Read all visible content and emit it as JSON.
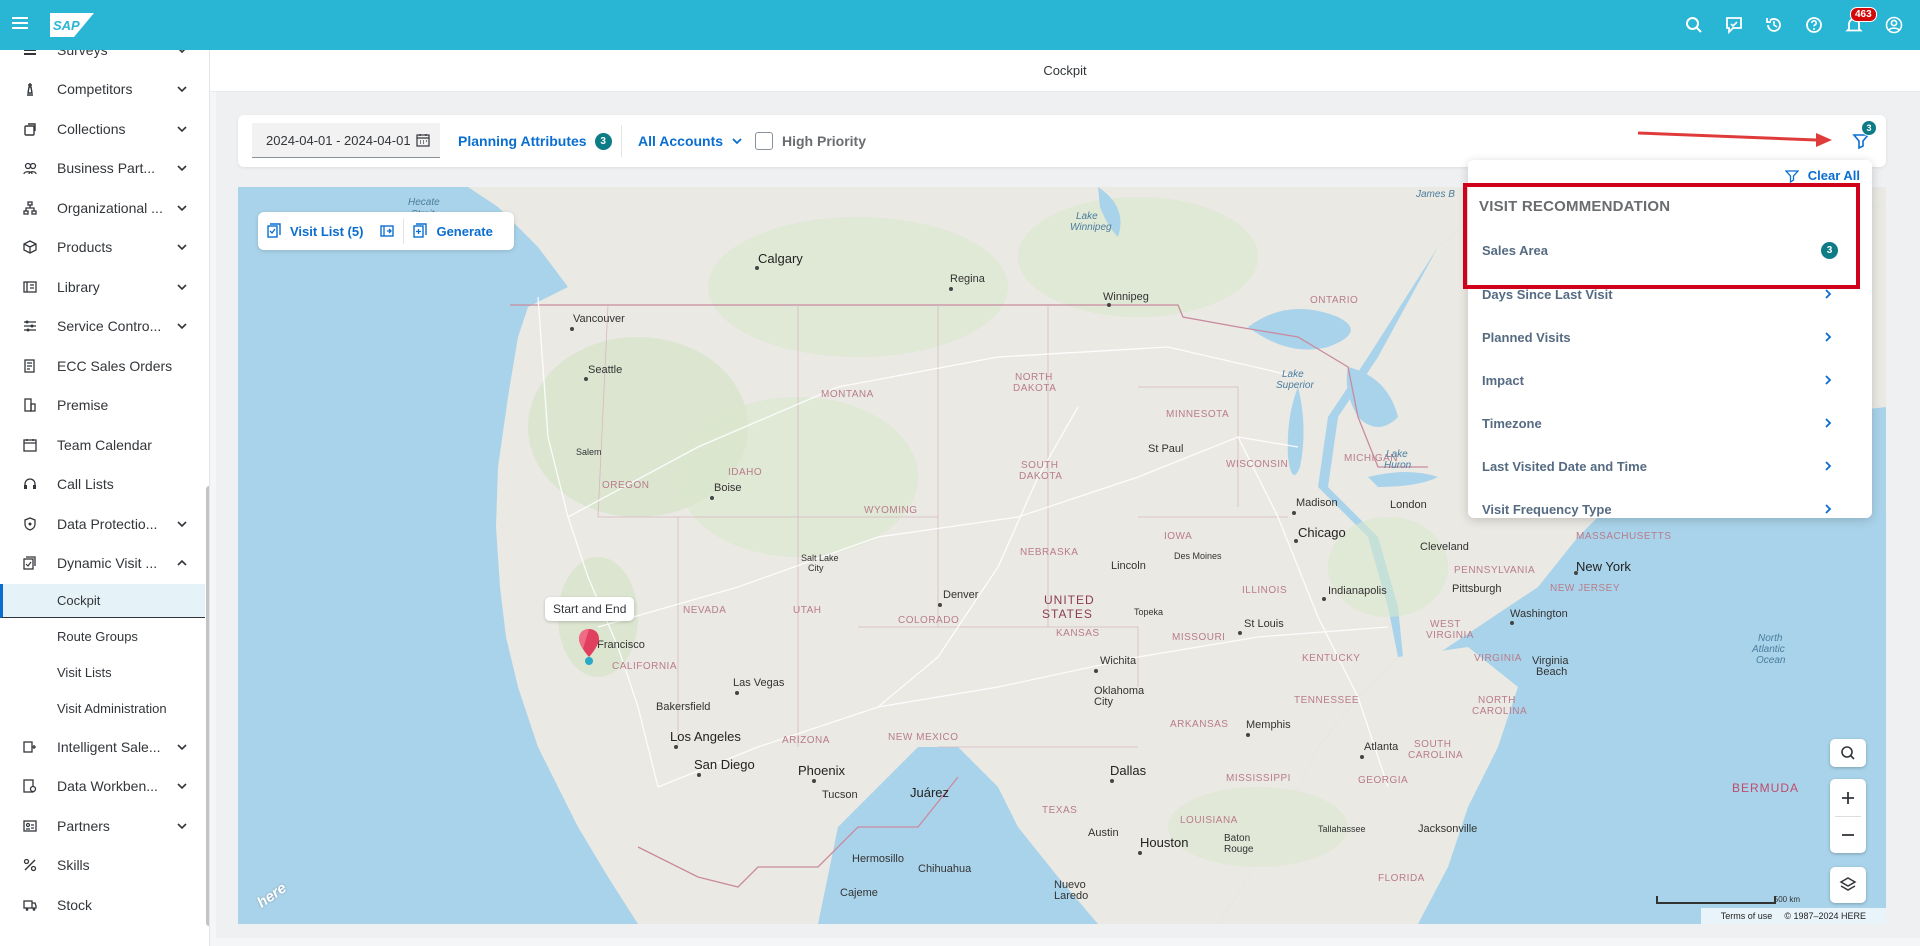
{
  "header": {
    "logo_text": "SAP",
    "notifications_count": "463"
  },
  "sidebar": {
    "items": [
      {
        "label": "Surveys",
        "icon": "list-icon",
        "expandable": true
      },
      {
        "label": "Competitors",
        "icon": "chess-icon",
        "expandable": true
      },
      {
        "label": "Collections",
        "icon": "collections-icon",
        "expandable": true
      },
      {
        "label": "Business Part...",
        "icon": "partners-icon",
        "expandable": true
      },
      {
        "label": "Organizational ...",
        "icon": "org-icon",
        "expandable": true
      },
      {
        "label": "Products",
        "icon": "product-icon",
        "expandable": true
      },
      {
        "label": "Library",
        "icon": "library-icon",
        "expandable": true
      },
      {
        "label": "Service Contro...",
        "icon": "controls-icon",
        "expandable": true
      },
      {
        "label": "ECC Sales Orders",
        "icon": "orders-icon",
        "expandable": false
      },
      {
        "label": "Premise",
        "icon": "building-icon",
        "expandable": false
      },
      {
        "label": "Team Calendar",
        "icon": "calendar-icon",
        "expandable": false
      },
      {
        "label": "Call Lists",
        "icon": "headset-icon",
        "expandable": false
      },
      {
        "label": "Data Protectio...",
        "icon": "shield-icon",
        "expandable": true
      },
      {
        "label": "Dynamic Visit ...",
        "icon": "visit-icon",
        "expandable": true,
        "expanded": true
      }
    ],
    "subitems": [
      {
        "label": "Cockpit",
        "active": true
      },
      {
        "label": "Route Groups"
      },
      {
        "label": "Visit Lists"
      },
      {
        "label": "Visit Administration"
      }
    ],
    "items_after": [
      {
        "label": "Intelligent Sale...",
        "icon": "intelligent-icon",
        "expandable": true
      },
      {
        "label": "Data Workben...",
        "icon": "workbench-icon",
        "expandable": true
      },
      {
        "label": "Partners",
        "icon": "partner-card-icon",
        "expandable": true
      },
      {
        "label": "Skills",
        "icon": "skills-icon",
        "expandable": false
      },
      {
        "label": "Stock",
        "icon": "truck-icon",
        "expandable": false
      }
    ]
  },
  "page": {
    "title": "Cockpit"
  },
  "filter_bar": {
    "date_range": "2024-04-01 - 2024-04-01",
    "planning_attributes_label": "Planning Attributes",
    "planning_attributes_count": "3",
    "accounts_label": "All Accounts",
    "high_priority_label": "High Priority",
    "filter_count": "3"
  },
  "map": {
    "visit_list_label": "Visit List (5)",
    "generate_label": "Generate",
    "tooltip": "Start and End",
    "scale_label": "500 km",
    "terms_label": "Terms of use",
    "copyright": "© 1987–2024 HERE",
    "provider_logo": "here",
    "labels": {
      "hecate": "Hecate",
      "strait": "Strait",
      "calgary": "Calgary",
      "regina": "Regina",
      "winnipeg": "Winnipeg",
      "lake_winnipeg": "Lake",
      "lake_winnipeg2": "Winnipeg",
      "vancouver": "Vancouver",
      "seattle": "Seattle",
      "ontario": "ONTARIO",
      "montana": "MONTANA",
      "north_dakota1": "NORTH",
      "north_dakota2": "DAKOTA",
      "minnesota": "MINNESOTA",
      "lake_superior1": "Lake",
      "lake_superior2": "Superior",
      "salem": "Salem",
      "oregon": "OREGON",
      "idaho": "IDAHO",
      "boise": "Boise",
      "wyoming": "WYOMING",
      "south_dakota1": "SOUTH",
      "south_dakota2": "DAKOTA",
      "st_paul": "St Paul",
      "wisconsin": "WISCONSIN",
      "michigan": "MICHIGAN",
      "lake_huron1": "Lake",
      "lake_huron2": "Huron",
      "madison": "Madison",
      "london": "London",
      "chicago": "Chicago",
      "iowa": "IOWA",
      "des_moines": "Des Moines",
      "nebraska": "NEBRASKA",
      "lincoln": "Lincoln",
      "nevada": "NEVADA",
      "utah": "UTAH",
      "salt_lake1": "Salt Lake",
      "salt_lake2": "City",
      "colorado": "COLORADO",
      "denver": "Denver",
      "united_states1": "UNITED",
      "united_states2": "STATES",
      "kansas": "KANSAS",
      "topeka": "Topeka",
      "missouri": "MISSOURI",
      "illinois": "ILLINOIS",
      "indianapolis": "Indianapolis",
      "st_louis": "St Louis",
      "cleveland": "Cleveland",
      "pittsburgh": "Pittsburgh",
      "pennsylvania": "PENNSYLVANIA",
      "new_york": "New York",
      "new_jersey": "NEW JERSEY",
      "massachusetts": "MASSACHUSETTS",
      "washington": "Washington",
      "west_virginia1": "WEST",
      "west_virginia2": "VIRGINIA",
      "kentucky": "KENTUCKY",
      "virginia": "VIRGINIA",
      "virginia_beach1": "Virginia",
      "virginia_beach2": "Beach",
      "north_atlantic1": "North",
      "north_atlantic2": "Atlantic",
      "north_atlantic3": "Ocean",
      "san_francisco": "n Francisco",
      "california": "CALIFORNIA",
      "las_vegas": "Las Vegas",
      "bakersfield": "Bakersfield",
      "los_angeles": "Los Angeles",
      "san_diego": "San Diego",
      "arizona": "ARIZONA",
      "phoenix": "Phoenix",
      "tucson": "Tucson",
      "new_mexico": "NEW MEXICO",
      "juarez": "Juárez",
      "wichita": "Wichita",
      "oklahoma1": "Oklahoma",
      "oklahoma2": "City",
      "tennessee": "TENNESSEE",
      "arkansas": "ARKANSAS",
      "memphis": "Memphis",
      "atlanta": "Atlanta",
      "south_carolina1": "SOUTH",
      "south_carolina2": "CAROLINA",
      "north_carolina1": "NORTH",
      "north_carolina2": "CAROLINA",
      "georgia": "GEORGIA",
      "mississippi": "MISSISSIPPI",
      "dallas": "Dallas",
      "texas": "TEXAS",
      "louisiana": "LOUISIANA",
      "austin": "Austin",
      "houston": "Houston",
      "baton_rouge1": "Baton",
      "baton_rouge2": "Rouge",
      "tallahassee": "Tallahassee",
      "jacksonville": "Jacksonville",
      "florida": "FLORIDA",
      "bermuda": "BERMUDA",
      "hermosillo": "Hermosillo",
      "chihuahua": "Chihuahua",
      "cajeme": "Cajeme",
      "nuevo_laredo1": "Nuevo",
      "nuevo_laredo2": "Laredo",
      "james_bay": "James B"
    }
  },
  "dropdown": {
    "clear_all_label": "Clear All",
    "heading": "VISIT RECOMMENDATION",
    "items": [
      {
        "label": "Sales Area",
        "count": "3"
      },
      {
        "label": "Days Since Last Visit"
      },
      {
        "label": "Planned Visits"
      },
      {
        "label": "Impact"
      },
      {
        "label": "Timezone"
      },
      {
        "label": "Last Visited Date and Time"
      },
      {
        "label": "Visit Frequency Type"
      }
    ]
  },
  "colors": {
    "header": "#29b5d4",
    "accent": "#0a6ed1",
    "badge": "#0e7c86",
    "highlight": "#d0021b",
    "arrow": "#e03b3b"
  }
}
